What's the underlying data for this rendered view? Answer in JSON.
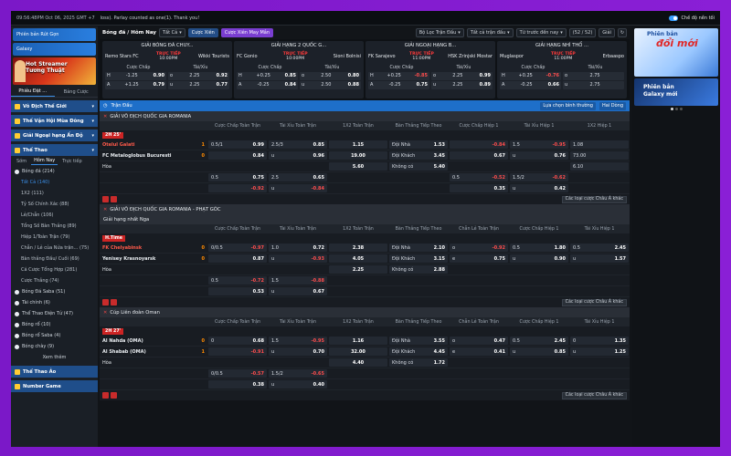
{
  "topbar": {
    "time": "09:56:48PM Oct 06, 2025 GMT +7",
    "ticker": "loss). Parlay counted as one(1). Thank you!",
    "dark_mode": "Chế độ nền tối"
  },
  "sidebar": {
    "promo1": "Phiên bản Rút Gọn",
    "promo2": "Galaxy",
    "banner": [
      "Hot Streamer",
      "Tương Thuật"
    ],
    "tabs": [
      "Phiêu Đặt ...",
      "Bảng Cược"
    ],
    "sections": [
      {
        "label": "Vô Địch Thế Giới"
      },
      {
        "label": "Thế Vận Hội Mùa Đông"
      },
      {
        "label": "Giải Ngoại hạng Ấn Độ"
      },
      {
        "label": "Thể Thao"
      }
    ],
    "subtabs": [
      "Sớm",
      "Hôm Nay",
      "Trực tiếp"
    ],
    "sports_top": [
      {
        "label": "Bóng đá (214)"
      }
    ],
    "football_sub": [
      {
        "label": "Tất Cả (140)",
        "active": true
      },
      {
        "label": "1X2 (111)"
      },
      {
        "label": "Tỷ Số Chính Xác (88)"
      },
      {
        "label": "Lẻ/Chẵn (106)"
      },
      {
        "label": "Tổng Số Bàn Thắng (89)"
      },
      {
        "label": "Hiệp 1/Toàn Trận (79)"
      },
      {
        "label": "Chẵn / Lẻ của Nửa trận... (75)"
      },
      {
        "label": "Bàn thắng Đầu/ Cuối (69)"
      },
      {
        "label": "Cá Cược Tổng Hợp (281)"
      },
      {
        "label": "Cược Thắng (74)"
      }
    ],
    "sports": [
      {
        "label": "Bóng Đá Saba (51)"
      },
      {
        "label": "Tài chính (6)"
      },
      {
        "label": "Thể Thao Điện Tử (47)"
      },
      {
        "label": "Bóng rổ (10)"
      },
      {
        "label": "Bóng rổ Saba (4)"
      },
      {
        "label": "Bóng chày (9)"
      }
    ],
    "more": "Xem thêm",
    "bottom": [
      {
        "label": "Thể Thao Ảo"
      },
      {
        "label": "Number Game"
      }
    ]
  },
  "filter": {
    "title": "Bóng đá / Hôm Nay",
    "sel1": "Tất Cả",
    "btn1": "Cược Xiên",
    "btn2": "Cược Xiên May Mắn",
    "sel2": "Bộ Lọc Trận Đấu",
    "sel3": "Tất cả trận đấu",
    "sel4": "Từ trước đến nay",
    "count": "(52 / 52)",
    "sel5": "Giải"
  },
  "featured": [
    {
      "league": "GIẢI BÓNG ĐÁ CHUY...",
      "home": "Remo Stars FC",
      "away": "Wikki Tourists",
      "status": "TRỰC TIẾP",
      "time": "10:00PM",
      "h1": "Cược Chấp",
      "h2": "Tài/Xỉu",
      "r1": [
        "H",
        "-1.25",
        "0.90",
        "o",
        "2.25",
        "0.92"
      ],
      "r2": [
        "A",
        "+1.25",
        "0.79",
        "u",
        "2.25",
        "0.77"
      ],
      "red": []
    },
    {
      "league": "GIẢI HẠNG 2 QUỐC G...",
      "home": "FC Gonio",
      "away": "Sioni Bolnisi",
      "status": "TRỰC TIẾP",
      "time": "10:00PM",
      "h1": "Cược Chấp",
      "h2": "Tài/Xỉu",
      "r1": [
        "H",
        "+0.25",
        "0.85",
        "o",
        "2.50",
        "0.80"
      ],
      "r2": [
        "A",
        "-0.25",
        "0.84",
        "u",
        "2.50",
        "0.88"
      ],
      "red": []
    },
    {
      "league": "GIẢI NGOẠI HẠNG B...",
      "home": "FK Sarajevo",
      "away": "HSK Zrinjski Mostar",
      "status": "TRỰC TIẾP",
      "time": "11:00PM",
      "h1": "Cược Chấp",
      "h2": "Tài/Xỉu",
      "r1": [
        "H",
        "+0.25",
        "-0.85",
        "o",
        "2.25",
        "0.99"
      ],
      "r2": [
        "A",
        "-0.25",
        "0.75",
        "u",
        "2.25",
        "0.89"
      ],
      "red": [
        "r1"
      ]
    },
    {
      "league": "GIẢI HẠNG NHÌ THỔ ...",
      "home": "Muglaspor",
      "away": "Erbaaspo",
      "status": "TRỰC TIẾP",
      "time": "11:00PM",
      "h1": "Cược Chấp",
      "h2": "Tài/Xỉu",
      "r1": [
        "H",
        "+0.25",
        "-0.76",
        "o",
        "2.75",
        ""
      ],
      "r2": [
        "A",
        "-0.25",
        "0.66",
        "u",
        "2.75",
        ""
      ],
      "red": [
        "r1"
      ]
    }
  ],
  "main_header": {
    "title": "Trận Đấu",
    "sort": "Lựa chọn bình thường",
    "odds": "Hai Dòng"
  },
  "matches": [
    {
      "league": "GIẢI VÔ ĐỊCH QUỐC GIA ROMANIA",
      "status": "2H 25'",
      "columns": [
        "Cược Chấp Toàn Trận",
        "Tài Xỉu Toàn Trận",
        "1X2 Toàn Trận",
        "Bàn Thắng Tiếp Theo",
        "Cược Chấp Hiệp 1",
        "Tài Xỉu Hiệp 1",
        "1X2 Hiệp 1"
      ],
      "home": {
        "name": "Otelul Galati",
        "score": "1",
        "red": true
      },
      "away": {
        "name": "FC Metaloglobus Bucuresti",
        "score": "0",
        "red": false
      },
      "draw": "Hòa",
      "rows": [
        [
          "0.5/1",
          "0.99",
          "2.5/3",
          "0.85",
          "1.15",
          "Đội Nhà",
          "1.53",
          "",
          "-0.84",
          "1.5",
          "-0.95",
          "1.08"
        ],
        [
          "",
          "0.84",
          "u",
          "0.96",
          "19.00",
          "Đội Khách",
          "3.45",
          "",
          "0.67",
          "u",
          "0.76",
          "73.00"
        ],
        [
          "",
          "",
          "",
          "",
          "5.60",
          "Không có",
          "5.40",
          "",
          "",
          "",
          "",
          "6.10"
        ],
        [
          "0.5",
          "0.75",
          "2.5",
          "0.65",
          "",
          "",
          "",
          "0.5",
          "-0.52",
          "1.5/2",
          "-0.62",
          ""
        ],
        [
          "",
          "-0.92",
          "u",
          "-0.84",
          "",
          "",
          "",
          "",
          "0.35",
          "u",
          "0.42",
          ""
        ]
      ],
      "more": "Các loại cược Châu Á khác"
    },
    {
      "league": "GIẢI VÔ ĐỊCH QUỐC GIA ROMANIA - PHẠT GÓC",
      "sub_league": "Giải hạng nhất Nga",
      "status": "H.Time",
      "columns": [
        "Cược Chấp Toàn Trận",
        "Tài Xỉu Toàn Trận",
        "1X2 Toàn Trận",
        "Bàn Thắng Tiếp Theo",
        "Chẵn Lẻ Toàn Trận",
        "Cược Chấp Hiệp 1",
        "Tài Xỉu Hiệp 1"
      ],
      "home": {
        "name": "FK Chelyabinsk",
        "score": "0",
        "red": true
      },
      "away": {
        "name": "Yenisey Krasnoyarsk",
        "score": "0",
        "red": false
      },
      "draw": "Hòa",
      "rows": [
        [
          "0/0.5",
          "-0.97",
          "1.0",
          "0.72",
          "2.38",
          "Đội Nhà",
          "2.10",
          "o",
          "-0.92",
          "0.5",
          "1.80",
          "0.5",
          "2.45"
        ],
        [
          "",
          "0.87",
          "u",
          "-0.93",
          "4.05",
          "Đội Khách",
          "3.15",
          "e",
          "0.75",
          "u",
          "0.90",
          "u",
          "1.57"
        ],
        [
          "",
          "",
          "",
          "",
          "2.25",
          "Không có",
          "2.88",
          "",
          "",
          "",
          "",
          "",
          ""
        ],
        [
          "0.5",
          "-0.72",
          "1.5",
          "-0.88",
          "",
          "",
          "",
          "",
          "",
          "",
          "",
          "",
          ""
        ],
        [
          "",
          "0.53",
          "u",
          "0.67",
          "",
          "",
          "",
          "",
          "",
          "",
          "",
          "",
          ""
        ]
      ],
      "more": "Các loại cược Châu Á khác"
    },
    {
      "league": "Cúp Liên đoàn Oman",
      "status": "2H 27'",
      "columns": [
        "Cược Chấp Toàn Trận",
        "Tài Xỉu Toàn Trận",
        "1X2 Toàn Trận",
        "Bàn Thắng Tiếp Theo",
        "Chẵn Lẻ Toàn Trận",
        "Cược Chấp Hiệp 1",
        "Tài Xỉu Hiệp 1"
      ],
      "home": {
        "name": "Al Nahda (OMA)",
        "score": "0",
        "red": false
      },
      "away": {
        "name": "Al Shabab (OMA)",
        "score": "1",
        "red": false
      },
      "draw": "Hòa",
      "rows": [
        [
          "0",
          "0.68",
          "1.5",
          "-0.95",
          "1.16",
          "Đội Nhà",
          "3.55",
          "o",
          "0.47",
          "0.5",
          "2.45",
          "0",
          "1.35"
        ],
        [
          "",
          "-0.91",
          "u",
          "0.70",
          "32.00",
          "Đội Khách",
          "4.45",
          "e",
          "0.41",
          "u",
          "0.85",
          "u",
          "1.25"
        ],
        [
          "",
          "",
          "",
          "",
          "4.40",
          "Không có",
          "1.72",
          "",
          "",
          "",
          "",
          "",
          ""
        ],
        [
          "0/0.5",
          "-0.57",
          "1.5/2",
          "-0.65",
          "",
          "",
          "",
          "",
          "",
          "",
          "",
          "",
          ""
        ],
        [
          "",
          "0.38",
          "u",
          "0.40",
          "",
          "",
          "",
          "",
          "",
          "",
          "",
          "",
          ""
        ]
      ],
      "more": "Các loại cược Châu Á khác"
    }
  ],
  "ads": {
    "ad1_line1": "Phiên bản",
    "ad1_line2": "đổi mới",
    "ad2_line1": "Phiên bản",
    "ad2_line2": "Galaxy mới"
  }
}
